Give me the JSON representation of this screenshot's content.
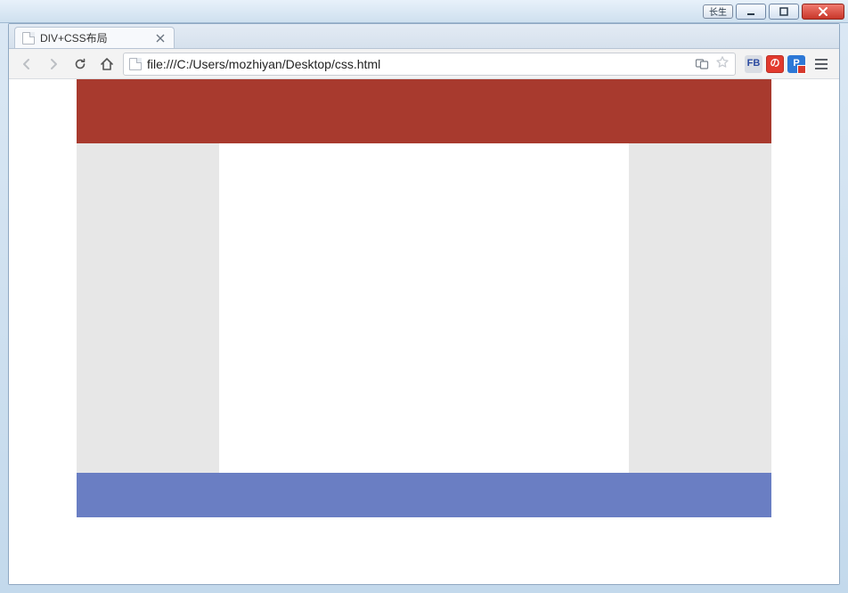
{
  "window": {
    "pill_label": "长生"
  },
  "tab": {
    "title": "DIV+CSS布局"
  },
  "toolbar": {
    "url": "file:///C:/Users/mozhiyan/Desktop/css.html"
  },
  "extensions": {
    "fb": "FB",
    "jd": "の",
    "p": "P"
  }
}
